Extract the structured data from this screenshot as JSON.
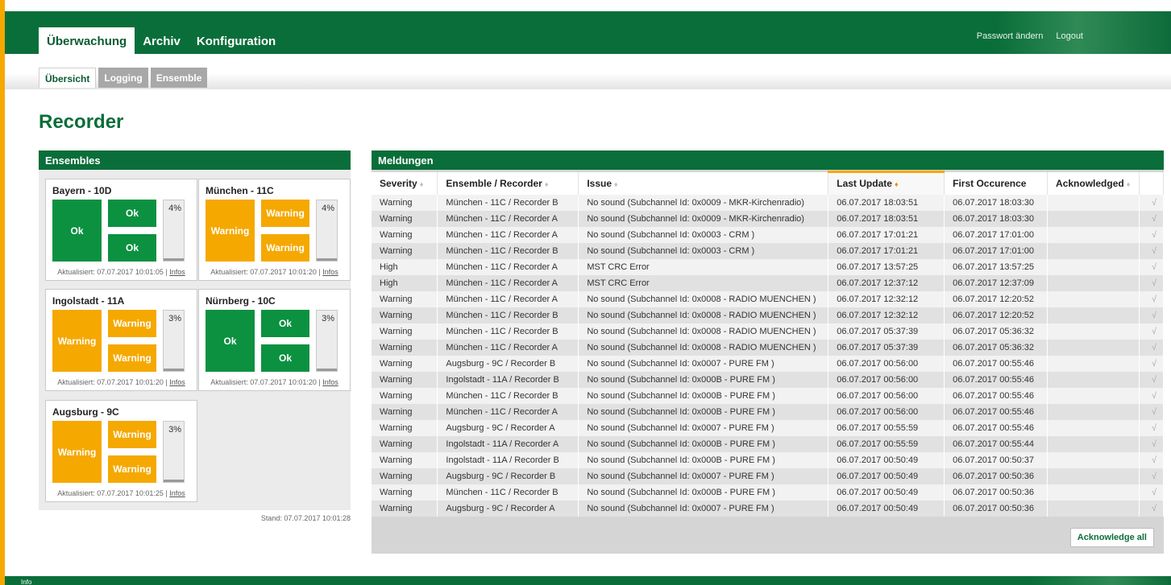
{
  "colors": {
    "brand_green": "#0a6e3a",
    "warning_orange": "#f5a800",
    "ok_green": "#0b9140"
  },
  "header": {
    "main_tabs": [
      {
        "label": "Überwachung",
        "active": true
      },
      {
        "label": "Archiv",
        "active": false
      },
      {
        "label": "Konfiguration",
        "active": false
      }
    ],
    "links": {
      "password": "Passwort ändern",
      "logout": "Logout"
    }
  },
  "subnav": {
    "tabs": [
      {
        "label": "Übersicht",
        "active": true
      },
      {
        "label": "Logging",
        "active": false
      },
      {
        "label": "Ensemble",
        "active": false
      }
    ]
  },
  "page": {
    "title": "Recorder"
  },
  "ensembles": {
    "title": "Ensembles",
    "updated_prefix": "Aktualisiert:",
    "infos_label": "Infos",
    "stand": "Stand: 07.07.2017 10:01:28",
    "items": [
      {
        "name": "Bayern - 10D",
        "main": "Ok",
        "rec_a": "Ok",
        "rec_b": "Ok",
        "main_status": "ok",
        "a_status": "ok",
        "b_status": "ok",
        "percent": "4%",
        "level": 0.04,
        "updated": "07.07.2017 10:01:05"
      },
      {
        "name": "München - 11C",
        "main": "Warning",
        "rec_a": "Warning",
        "rec_b": "Warning",
        "main_status": "warn",
        "a_status": "warn",
        "b_status": "warn",
        "percent": "4%",
        "level": 0.04,
        "updated": "07.07.2017 10:01:20"
      },
      {
        "name": "Ingolstadt - 11A",
        "main": "Warning",
        "rec_a": "Warning",
        "rec_b": "Warning",
        "main_status": "warn",
        "a_status": "warn",
        "b_status": "warn",
        "percent": "3%",
        "level": 0.03,
        "updated": "07.07.2017 10:01:20"
      },
      {
        "name": "Nürnberg - 10C",
        "main": "Ok",
        "rec_a": "Ok",
        "rec_b": "Ok",
        "main_status": "ok",
        "a_status": "ok",
        "b_status": "ok",
        "percent": "3%",
        "level": 0.03,
        "updated": "07.07.2017 10:01:20"
      },
      {
        "name": "Augsburg - 9C",
        "main": "Warning",
        "rec_a": "Warning",
        "rec_b": "Warning",
        "main_status": "warn",
        "a_status": "warn",
        "b_status": "warn",
        "percent": "3%",
        "level": 0.03,
        "updated": "07.07.2017 10:01:25"
      }
    ]
  },
  "messages": {
    "title": "Meldungen",
    "columns": [
      "Severity",
      "Ensemble / Recorder",
      "Issue",
      "Last Update",
      "First Occurence",
      "Acknowledged"
    ],
    "sorted_column": "Last Update",
    "ack_mark": "√",
    "acknowledge_all_label": "Acknowledge all",
    "rows": [
      [
        "Warning",
        "München - 11C / Recorder B",
        "No sound (Subchannel Id: 0x0009 - MKR-Kirchenradio)",
        "06.07.2017 18:03:51",
        "06.07.2017 18:03:30"
      ],
      [
        "Warning",
        "München - 11C / Recorder A",
        "No sound (Subchannel Id: 0x0009 - MKR-Kirchenradio)",
        "06.07.2017 18:03:51",
        "06.07.2017 18:03:30"
      ],
      [
        "Warning",
        "München - 11C / Recorder A",
        "No sound (Subchannel Id: 0x0003 - CRM )",
        "06.07.2017 17:01:21",
        "06.07.2017 17:01:00"
      ],
      [
        "Warning",
        "München - 11C / Recorder B",
        "No sound (Subchannel Id: 0x0003 - CRM )",
        "06.07.2017 17:01:21",
        "06.07.2017 17:01:00"
      ],
      [
        "High",
        "München - 11C / Recorder A",
        "MST CRC Error",
        "06.07.2017 13:57:25",
        "06.07.2017 13:57:25"
      ],
      [
        "High",
        "München - 11C / Recorder A",
        "MST CRC Error",
        "06.07.2017 12:37:12",
        "06.07.2017 12:37:09"
      ],
      [
        "Warning",
        "München - 11C / Recorder A",
        "No sound (Subchannel Id: 0x0008 - RADIO MUENCHEN )",
        "06.07.2017 12:32:12",
        "06.07.2017 12:20:52"
      ],
      [
        "Warning",
        "München - 11C / Recorder B",
        "No sound (Subchannel Id: 0x0008 - RADIO MUENCHEN )",
        "06.07.2017 12:32:12",
        "06.07.2017 12:20:52"
      ],
      [
        "Warning",
        "München - 11C / Recorder B",
        "No sound (Subchannel Id: 0x0008 - RADIO MUENCHEN )",
        "06.07.2017 05:37:39",
        "06.07.2017 05:36:32"
      ],
      [
        "Warning",
        "München - 11C / Recorder A",
        "No sound (Subchannel Id: 0x0008 - RADIO MUENCHEN )",
        "06.07.2017 05:37:39",
        "06.07.2017 05:36:32"
      ],
      [
        "Warning",
        "Augsburg - 9C / Recorder B",
        "No sound (Subchannel Id: 0x0007 - PURE FM )",
        "06.07.2017 00:56:00",
        "06.07.2017 00:55:46"
      ],
      [
        "Warning",
        "Ingolstadt - 11A / Recorder B",
        "No sound (Subchannel Id: 0x000B - PURE FM )",
        "06.07.2017 00:56:00",
        "06.07.2017 00:55:46"
      ],
      [
        "Warning",
        "München - 11C / Recorder B",
        "No sound (Subchannel Id: 0x000B - PURE FM )",
        "06.07.2017 00:56:00",
        "06.07.2017 00:55:46"
      ],
      [
        "Warning",
        "München - 11C / Recorder A",
        "No sound (Subchannel Id: 0x000B - PURE FM )",
        "06.07.2017 00:56:00",
        "06.07.2017 00:55:46"
      ],
      [
        "Warning",
        "Augsburg - 9C / Recorder A",
        "No sound (Subchannel Id: 0x0007 - PURE FM )",
        "06.07.2017 00:55:59",
        "06.07.2017 00:55:46"
      ],
      [
        "Warning",
        "Ingolstadt - 11A / Recorder A",
        "No sound (Subchannel Id: 0x000B - PURE FM )",
        "06.07.2017 00:55:59",
        "06.07.2017 00:55:44"
      ],
      [
        "Warning",
        "Ingolstadt - 11A / Recorder B",
        "No sound (Subchannel Id: 0x000B - PURE FM )",
        "06.07.2017 00:50:49",
        "06.07.2017 00:50:37"
      ],
      [
        "Warning",
        "Augsburg - 9C / Recorder B",
        "No sound (Subchannel Id: 0x0007 - PURE FM )",
        "06.07.2017 00:50:49",
        "06.07.2017 00:50:36"
      ],
      [
        "Warning",
        "München - 11C / Recorder B",
        "No sound (Subchannel Id: 0x000B - PURE FM )",
        "06.07.2017 00:50:49",
        "06.07.2017 00:50:36"
      ],
      [
        "Warning",
        "Augsburg - 9C / Recorder A",
        "No sound (Subchannel Id: 0x0007 - PURE FM )",
        "06.07.2017 00:50:49",
        "06.07.2017 00:50:36"
      ]
    ]
  },
  "footer": {
    "label": "Info"
  }
}
